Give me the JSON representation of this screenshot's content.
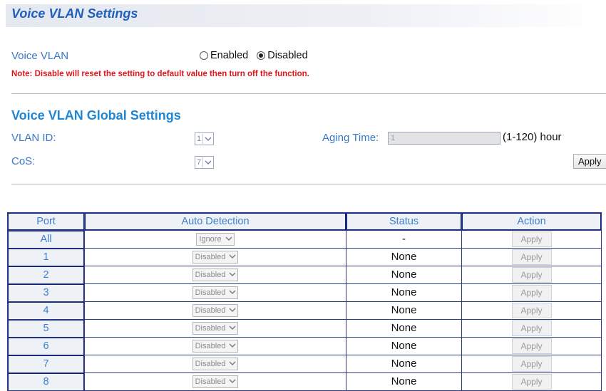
{
  "page": {
    "title": "Voice VLAN Settings"
  },
  "voice_vlan": {
    "label": "Voice VLAN",
    "options": [
      {
        "label": "Enabled",
        "checked": false
      },
      {
        "label": "Disabled",
        "checked": true
      }
    ]
  },
  "note": "Note: Disable will reset the setting to default value then turn off the function.",
  "global": {
    "section_title": "Voice VLAN Global Settings",
    "vlan_id_label": "VLAN ID:",
    "vlan_id_value": "1",
    "cos_label": "CoS:",
    "cos_value": "7",
    "aging_label": "Aging Time:",
    "aging_value": "1",
    "aging_unit": "(1-120) hour",
    "apply_label": "Apply"
  },
  "table": {
    "headers": [
      "Port",
      "Auto Detection",
      "Status",
      "Action"
    ],
    "rows": [
      {
        "port": "All",
        "detection": "Ignore",
        "status": "-",
        "action": "Apply"
      },
      {
        "port": "1",
        "detection": "Disabled",
        "status": "None",
        "action": "Apply"
      },
      {
        "port": "2",
        "detection": "Disabled",
        "status": "None",
        "action": "Apply"
      },
      {
        "port": "3",
        "detection": "Disabled",
        "status": "None",
        "action": "Apply"
      },
      {
        "port": "4",
        "detection": "Disabled",
        "status": "None",
        "action": "Apply"
      },
      {
        "port": "5",
        "detection": "Disabled",
        "status": "None",
        "action": "Apply"
      },
      {
        "port": "6",
        "detection": "Disabled",
        "status": "None",
        "action": "Apply"
      },
      {
        "port": "7",
        "detection": "Disabled",
        "status": "None",
        "action": "Apply"
      },
      {
        "port": "8",
        "detection": "Disabled",
        "status": "None",
        "action": "Apply"
      }
    ]
  },
  "colors": {
    "title": "#1f5fbd",
    "section_title": "#1f86d6",
    "label": "#3778c8",
    "note": "#e0151b",
    "table_border": "#0f1f80",
    "header_cell_bg": "#eef1f6"
  }
}
